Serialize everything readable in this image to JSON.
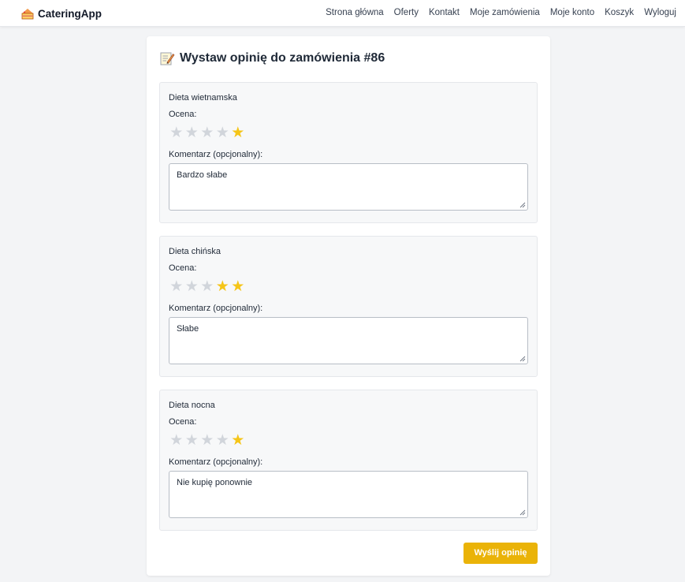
{
  "nav": {
    "brand": "CateringApp",
    "links": [
      "Strona główna",
      "Oferty",
      "Kontakt",
      "Moje zamówienia",
      "Moje konto",
      "Koszyk",
      "Wyloguj"
    ]
  },
  "form": {
    "title": "Wystaw opinię do zamówienia #86",
    "rating_label": "Ocena:",
    "comment_label": "Komentarz (opcjonalny):",
    "submit_label": "Wyślij opinię",
    "star_glyph": "★",
    "star_on_color": "#f5c518",
    "star_off_color": "#d1d5db",
    "items": [
      {
        "name": "Dieta wietnamska",
        "rating": 1,
        "comment": "Bardzo słabe"
      },
      {
        "name": "Dieta chińska",
        "rating": 2,
        "comment": "Słabe"
      },
      {
        "name": "Dieta nocna",
        "rating": 1,
        "comment": "Nie kupię ponownie"
      }
    ]
  }
}
